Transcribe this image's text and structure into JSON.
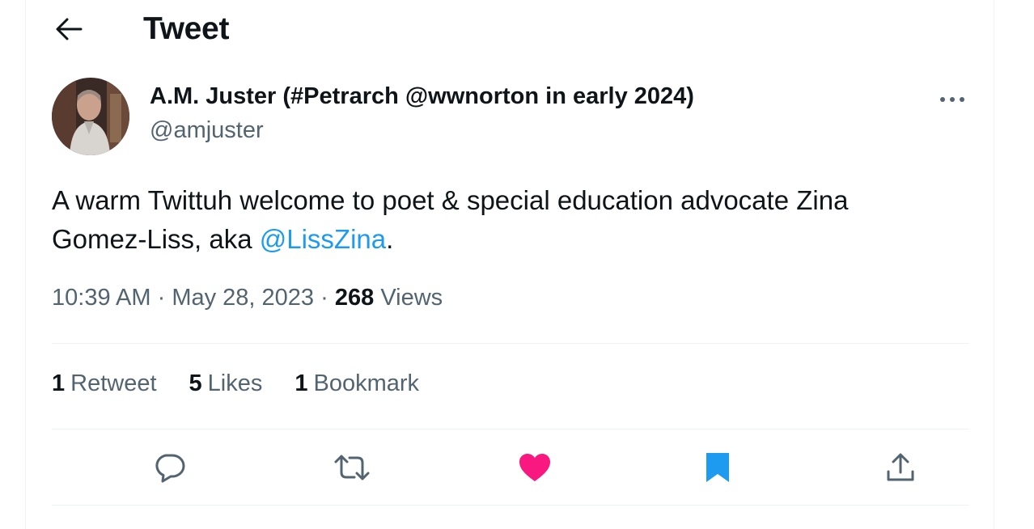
{
  "header": {
    "title": "Tweet",
    "back_icon": "arrow-left-icon"
  },
  "tweet": {
    "author": {
      "display_name": "A.M. Juster (#Petrarch @wwnorton in early 2024)",
      "handle": "@amjuster"
    },
    "text_before": "A warm Twittuh welcome to poet & special education advocate Zina Gomez-Liss, aka ",
    "mention": "@LissZina",
    "text_after": ".",
    "time": "10:39 AM",
    "date": "May 28, 2023",
    "separator": "·",
    "views_count": "268",
    "views_label": "Views"
  },
  "stats": {
    "retweets_count": "1",
    "retweets_label": "Retweet",
    "likes_count": "5",
    "likes_label": "Likes",
    "bookmarks_count": "1",
    "bookmarks_label": "Bookmark"
  },
  "actions": {
    "reply_icon": "reply-icon",
    "retweet_icon": "retweet-icon",
    "like_icon": "heart-icon",
    "bookmark_icon": "bookmark-icon",
    "share_icon": "share-icon"
  },
  "colors": {
    "accent": "#1d9bf0",
    "like": "#f91880",
    "muted": "#536471",
    "text": "#0f1419",
    "divider": "#eff3f4"
  }
}
